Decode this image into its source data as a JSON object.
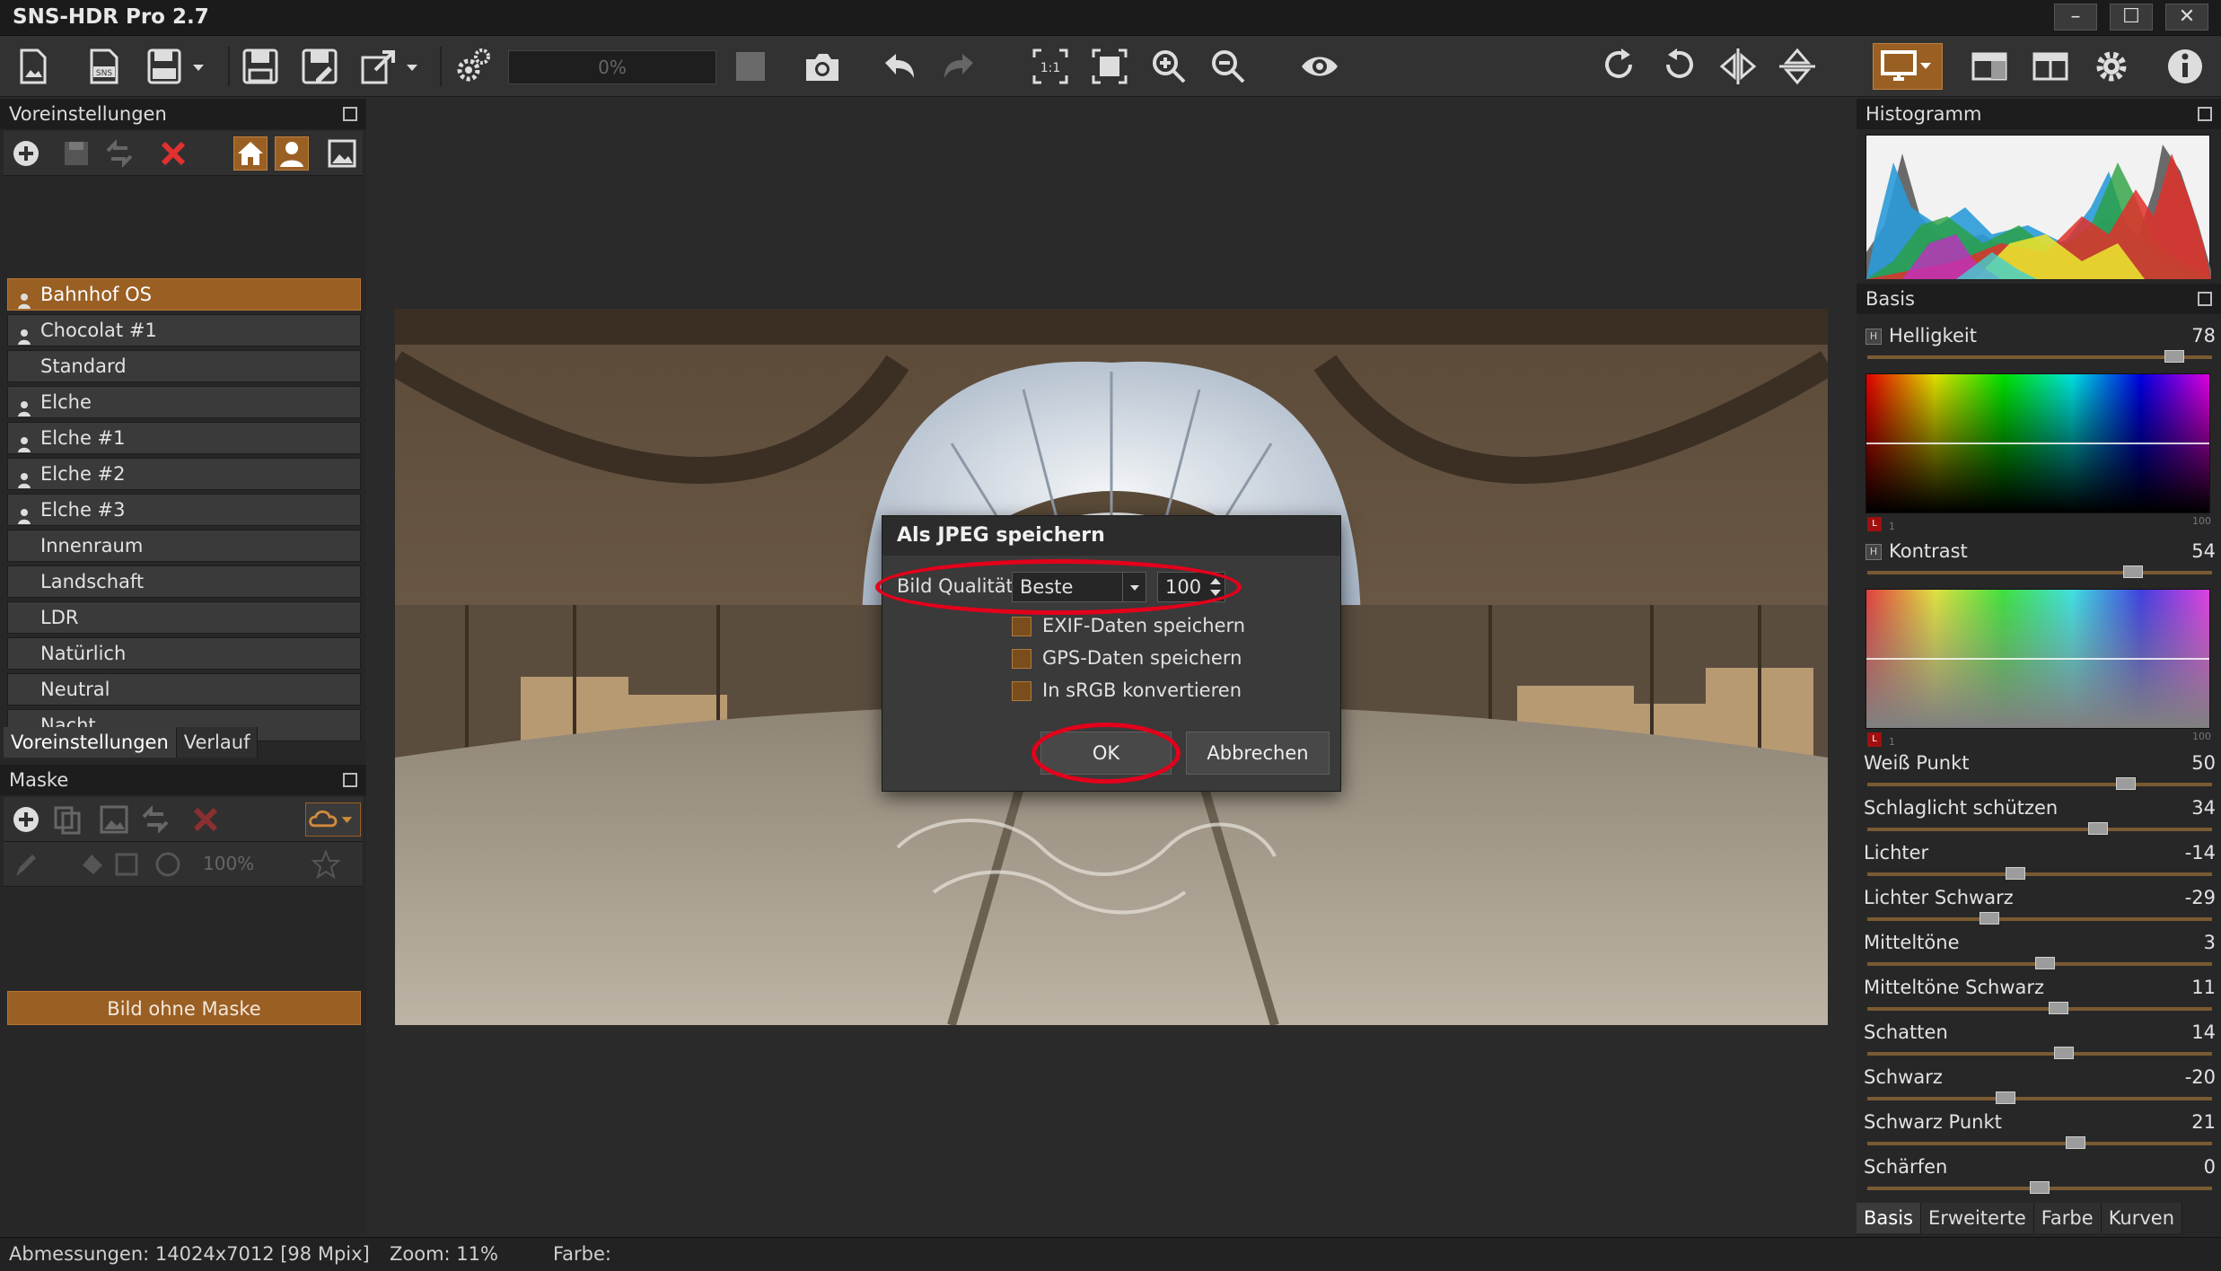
{
  "window": {
    "title": "SNS-HDR Pro 2.7",
    "min": "–",
    "max": "☐",
    "close": "✕"
  },
  "toolbar": {
    "progress": "0%"
  },
  "left": {
    "presets_title": "Voreinstellungen",
    "presets": [
      {
        "label": "Bahnhof OS",
        "user": true,
        "selected": true
      },
      {
        "label": "Chocolat #1",
        "user": true
      },
      {
        "label": "Standard",
        "user": false
      },
      {
        "label": "Elche",
        "user": true
      },
      {
        "label": "Elche #1",
        "user": true
      },
      {
        "label": "Elche #2",
        "user": true
      },
      {
        "label": "Elche #3",
        "user": true
      },
      {
        "label": "Innenraum",
        "user": false
      },
      {
        "label": "Landschaft",
        "user": false
      },
      {
        "label": "LDR",
        "user": false
      },
      {
        "label": "Natürlich",
        "user": false
      },
      {
        "label": "Neutral",
        "user": false
      },
      {
        "label": "Nacht",
        "user": false
      }
    ],
    "tabs": [
      "Voreinstellungen",
      "Verlauf"
    ],
    "mask_title": "Maske",
    "mask_zoom": "100%",
    "no_mask": "Bild ohne Maske"
  },
  "dialog": {
    "title": "Als JPEG speichern",
    "quality_label": "Bild Qualität",
    "quality_value": "Beste",
    "quality_number": "100",
    "exif": "EXIF-Daten speichern",
    "gps": "GPS-Daten speichern",
    "srgb": "In sRGB konvertieren",
    "ok": "OK",
    "cancel": "Abbrechen"
  },
  "right": {
    "histogram_title": "Histogramm",
    "basis_title": "Basis",
    "helligkeit": {
      "label": "Helligkeit",
      "value": "78",
      "level": 0.89
    },
    "kontrast": {
      "label": "Kontrast",
      "value": "54",
      "level": 0.77
    },
    "sliders": [
      {
        "label": "Weiß Punkt",
        "value": "50",
        "level": 0.75
      },
      {
        "label": "Schlaglicht schützen",
        "value": "34",
        "level": 0.67
      },
      {
        "label": "Lichter",
        "value": "-14",
        "level": 0.43
      },
      {
        "label": "Lichter Schwarz",
        "value": "-29",
        "level": 0.355
      },
      {
        "label": "Mitteltöne",
        "value": "3",
        "level": 0.515
      },
      {
        "label": "Mitteltöne Schwarz",
        "value": "11",
        "level": 0.555
      },
      {
        "label": "Schatten",
        "value": "14",
        "level": 0.57
      },
      {
        "label": "Schwarz",
        "value": "-20",
        "level": 0.4
      },
      {
        "label": "Schwarz Punkt",
        "value": "21",
        "level": 0.605
      },
      {
        "label": "Schärfen",
        "value": "0",
        "level": 0.5
      }
    ],
    "grad_l": "L",
    "grad_1": "1",
    "grad_100": "100",
    "tabs": [
      "Basis",
      "Erweiterte",
      "Farbe",
      "Kurven"
    ]
  },
  "status": {
    "dimensions": "Abmessungen: 14024x7012 [98 Mpix]",
    "zoom": "Zoom: 11%",
    "color": "Farbe:"
  },
  "colors": {
    "accent": "#9a5f23",
    "highlight": "#e3001b"
  }
}
